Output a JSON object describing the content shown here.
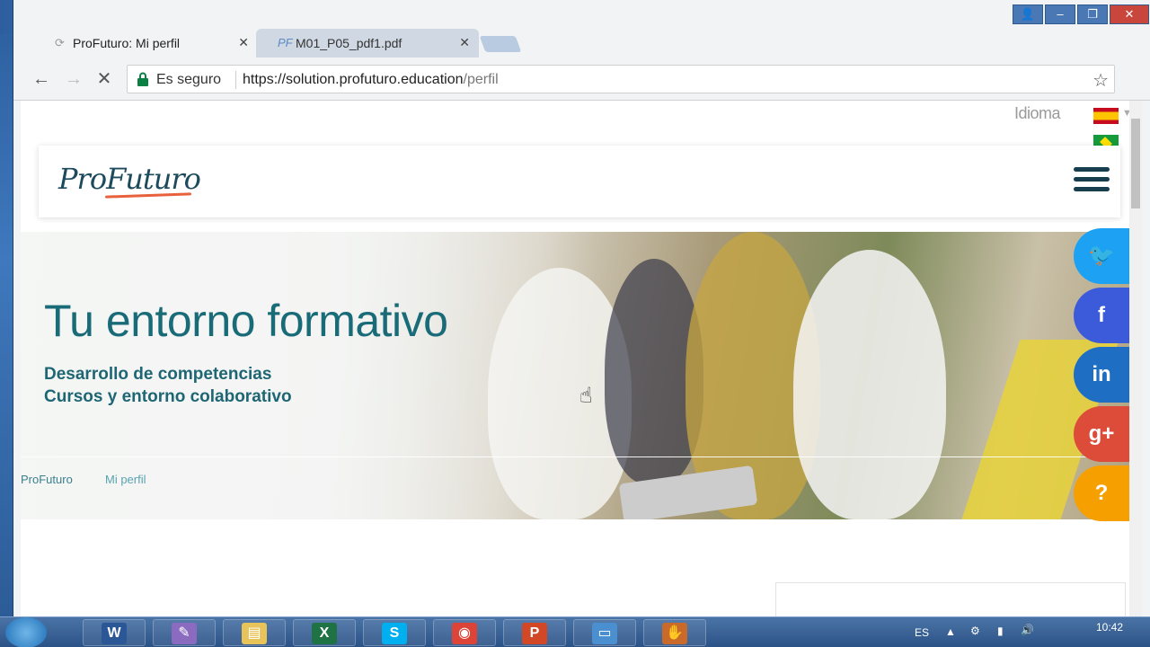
{
  "browser": {
    "tabs": [
      {
        "title": "ProFuturo: Mi perfil",
        "icon": "loading-icon",
        "active": true
      },
      {
        "title": "M01_P05_pdf1.pdf",
        "icon": "pdf-icon",
        "active": false
      }
    ],
    "security_label": "Es seguro",
    "url_host": "https://solution.profuturo.education",
    "url_path": "/perfil"
  },
  "page": {
    "language_label": "Idioma",
    "logo_text": "ProFuturo",
    "hero": {
      "title": "Tu entorno formativo",
      "subtitle_1": "Desarrollo de competencias",
      "subtitle_2": "Cursos y entorno colaborativo"
    },
    "breadcrumb": {
      "home": "ProFuturo",
      "current": "Mi perfil"
    },
    "social": [
      {
        "name": "twitter",
        "glyph": "🐦",
        "color": "#1da1f2"
      },
      {
        "name": "facebook",
        "glyph": "f",
        "color": "#3b5bdb"
      },
      {
        "name": "linkedin",
        "glyph": "in",
        "color": "#1e6fc4"
      },
      {
        "name": "googleplus",
        "glyph": "g+",
        "color": "#dd4b39"
      },
      {
        "name": "help",
        "glyph": "?",
        "color": "#f5a000"
      }
    ]
  },
  "taskbar": {
    "apps": [
      "word",
      "paint",
      "explorer",
      "excel",
      "skype",
      "chrome",
      "powerpoint",
      "photos",
      "game"
    ],
    "language": "ES",
    "time": "10:42"
  }
}
